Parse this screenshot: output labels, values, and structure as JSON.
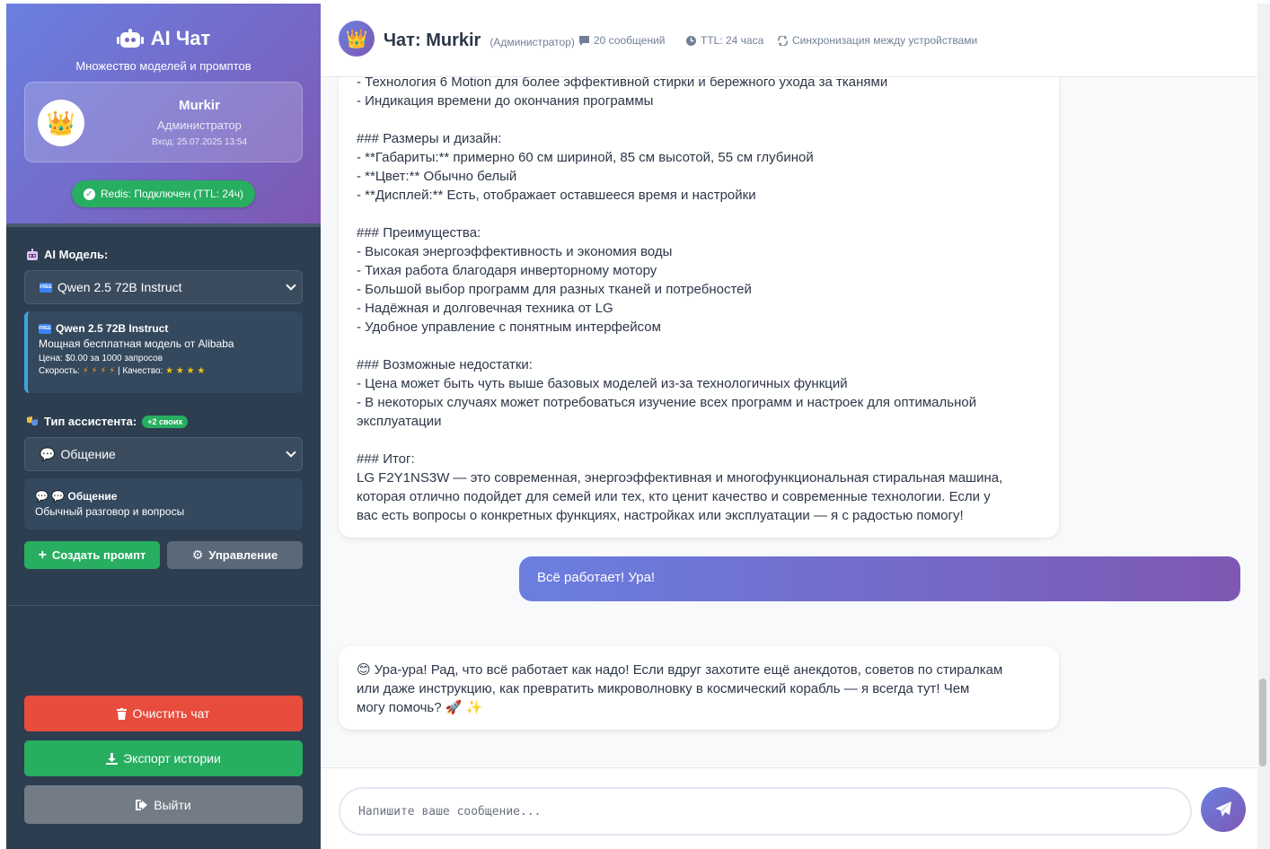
{
  "sidebar": {
    "title": "AI Чат",
    "subtitle": "Множество моделей и промптов",
    "user": {
      "avatar": "👑",
      "name": "Murkir",
      "role": "Администратор",
      "login": "Вход: 25.07.2025 13:54"
    },
    "redis_status": "Redis: Подключен (TTL: 24ч)",
    "model_label": "AI Модель:",
    "model_select": "Qwen 2.5 72B Instruct",
    "model_card": {
      "title": "Qwen 2.5 72B Instruct",
      "description": "Мощная бесплатная модель от Alibaba",
      "price": "Цена: $0.00 за 1000 запросов",
      "speed_label": "Скорость:",
      "speed_icons": "⚡ ⚡ ⚡ ⚡",
      "quality_label": "| Качество:",
      "quality_icons": "★ ★ ★ ★"
    },
    "assistant_label": "Тип ассистента:",
    "assistant_badge": "+2 своих",
    "assistant_select": "Общение",
    "assistant_card": {
      "title": "💬 💬 Общение",
      "description": "Обычный разговор и вопросы"
    },
    "create_prompt": "Создать промпт",
    "manage": "Управление",
    "clear_chat": "Очистить чат",
    "export_history": "Экспорт истории",
    "logout": "Выйти"
  },
  "header": {
    "avatar": "👑",
    "title": "Чат: Murkir",
    "role": "(Администратор)",
    "messages_count": "20 сообщений",
    "ttl": "TTL: 24 часа",
    "sync": "Синхронизация между устройствами"
  },
  "messages": [
    {
      "role": "assistant",
      "text": "- Технология 6 Motion для более эффективной стирки и бережного ухода за тканями\n- Индикация времени до окончания программы\n\n### Размеры и дизайн:\n- **Габариты:** примерно 60 см шириной, 85 см высотой, 55 см глубиной\n- **Цвет:** Обычно белый\n- **Дисплей:** Есть, отображает оставшееся время и настройки\n\n### Преимущества:\n- Высокая энергоэффективность и экономия воды\n- Тихая работа благодаря инверторному мотору\n- Большой выбор программ для разных тканей и потребностей\n- Надёжная и долговечная техника от LG\n- Удобное управление с понятным интерфейсом\n\n### Возможные недостатки:\n- Цена может быть чуть выше базовых моделей из-за технологичных функций\n- В некоторых случаях может потребоваться изучение всех программ и настроек для оптимальной\nэксплуатации\n\n### Итог:\nLG F2Y1NS3W — это современная, энергоэффективная и многофункциональная стиральная машина,\nкоторая отлично подойдет для семей или тех, кто ценит качество и современные технологии. Если у\nвас есть вопросы о конкретных функциях, настройках или эксплуатации — я с радостью помогу!"
    },
    {
      "role": "user",
      "text": "Всё работает! Ура!"
    },
    {
      "role": "assistant",
      "text": "😊 Ура-ура! Рад, что всё работает как надо! Если вдруг захотите ещё анекдотов, советов по стиралкам\nили даже инструкцию, как превратить микроволновку в космический корабль — я всегда тут! Чем\nмогу помочь? 🚀 ✨"
    }
  ],
  "input": {
    "placeholder": "Напишите ваше сообщение..."
  },
  "colors": {
    "accent_start": "#6a7fe0",
    "accent_end": "#7e58b3",
    "sidebar_bg": "#2c3e50",
    "success": "#27ae60",
    "danger": "#e74c3c"
  },
  "icons": {
    "title": "robot-icon",
    "redis": "check-circle-icon",
    "model_label": "robot-face-icon",
    "assistant_label": "theater-masks-icon",
    "create": "plus-icon",
    "manage": "gear-icon",
    "clear": "trash-icon",
    "export": "download-icon",
    "logout": "sign-out-icon",
    "send": "paper-plane-icon",
    "messages_count": "comment-icon",
    "ttl": "clock-icon",
    "sync": "sync-icon"
  }
}
